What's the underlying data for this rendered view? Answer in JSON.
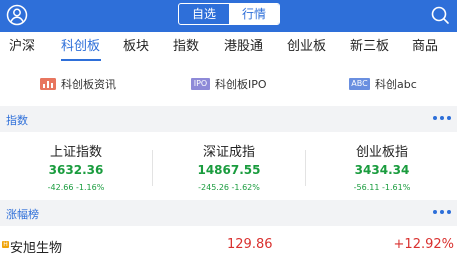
{
  "header": {
    "segments": [
      {
        "label": "自选",
        "active": false
      },
      {
        "label": "行情",
        "active": true
      }
    ],
    "icons": {
      "left": "user-icon",
      "right": "search-icon"
    },
    "colors": {
      "primary": "#2e6fd9"
    }
  },
  "tabs": [
    {
      "label": "沪深"
    },
    {
      "label": "科创板",
      "active": true
    },
    {
      "label": "板块"
    },
    {
      "label": "指数"
    },
    {
      "label": "港股通"
    },
    {
      "label": "创业板"
    },
    {
      "label": "新三板"
    },
    {
      "label": "商品"
    }
  ],
  "sub_links": [
    {
      "label": "科创板资讯",
      "icon": "news-chart-icon",
      "icon_text": "",
      "icon_color": "#e8765f"
    },
    {
      "label": "科创板IPO",
      "icon": "ipo-icon",
      "icon_text": "IPO",
      "icon_color": "#8e8ad8"
    },
    {
      "label": "科创abc",
      "icon": "abc-icon",
      "icon_text": "ABC",
      "icon_color": "#6a8fe0"
    }
  ],
  "indices_section": {
    "title": "指数",
    "items": [
      {
        "name": "上证指数",
        "value": "3632.36",
        "change": "-42.66 -1.16%"
      },
      {
        "name": "深证成指",
        "value": "14867.55",
        "change": "-245.26 -1.62%"
      },
      {
        "name": "创业板指",
        "value": "3434.34",
        "change": "-56.11 -1.61%"
      }
    ],
    "colors": {
      "down": "#1a9c3e"
    }
  },
  "gainers_section": {
    "title": "涨幅榜",
    "rows": [
      {
        "tag": "H",
        "name": "安旭生物",
        "price": "129.86",
        "change_pct": "+12.92%"
      }
    ],
    "colors": {
      "up": "#d9312f",
      "tag": "#f0a30a"
    }
  }
}
